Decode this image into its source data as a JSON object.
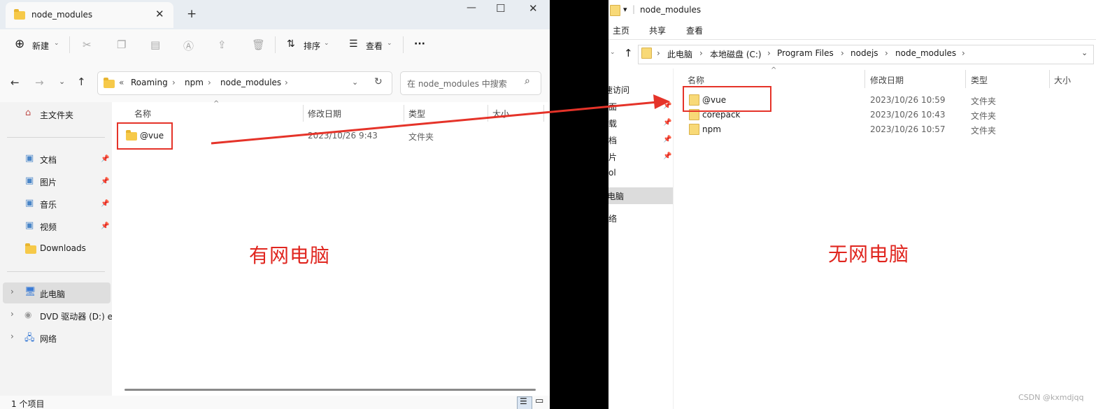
{
  "left_window": {
    "tab_title": "node_modules",
    "toolbar": {
      "new_label": "新建",
      "sort_label": "排序",
      "view_label": "查看",
      "more_label": "···"
    },
    "breadcrumb": [
      "«",
      "Roaming",
      "npm",
      "node_modules"
    ],
    "search_placeholder": "在 node_modules 中搜索",
    "nav": {
      "home": "主文件夹",
      "quick": [
        "文档",
        "图片",
        "音乐",
        "视频",
        "Downloads"
      ],
      "this_pc": "此电脑",
      "dvd": "DVD 驱动器 (D:) e",
      "network": "网络"
    },
    "columns": {
      "name": "名称",
      "date": "修改日期",
      "type": "类型",
      "size": "大小"
    },
    "files": [
      {
        "name": "@vue",
        "date": "2023/10/26 9:43",
        "type": "文件夹"
      }
    ],
    "status": "1 个项目"
  },
  "right_window": {
    "title": "node_modules",
    "ribbon": [
      "主页",
      "共享",
      "查看"
    ],
    "breadcrumb": [
      "此电脑",
      "本地磁盘 (C:)",
      "Program Files",
      "nodejs",
      "node_modules"
    ],
    "nav_partial": [
      "速访问",
      "面",
      "载",
      "档",
      "片",
      "ol",
      "电脑",
      "络"
    ],
    "columns": {
      "name": "名称",
      "date": "修改日期",
      "type": "类型",
      "size": "大小"
    },
    "files": [
      {
        "name": "@vue",
        "date": "2023/10/26 10:59",
        "type": "文件夹"
      },
      {
        "name": "corepack",
        "date": "2023/10/26 10:43",
        "type": "文件夹"
      },
      {
        "name": "npm",
        "date": "2023/10/26 10:57",
        "type": "文件夹"
      }
    ]
  },
  "annotations": {
    "left_label": "有网电脑",
    "right_label": "无网电脑",
    "watermark": "CSDN @kxmdjqq"
  },
  "colors": {
    "annotation_red": "#e0261f",
    "folder_yellow": "#f6c949"
  }
}
